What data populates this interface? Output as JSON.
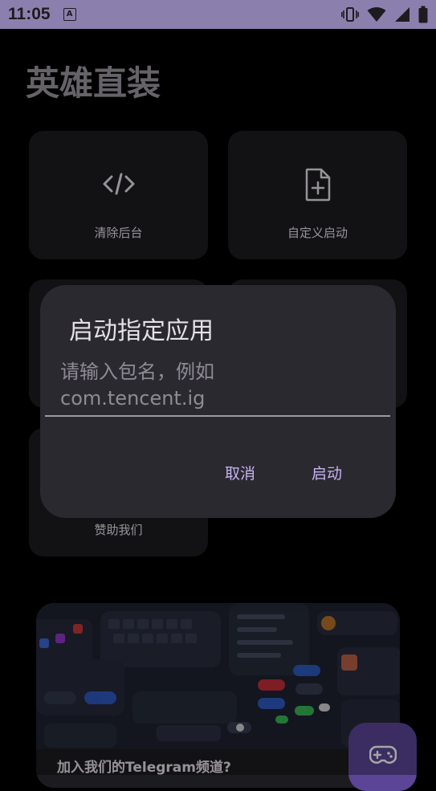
{
  "status_bar": {
    "time": "11:05",
    "notification_icon": "A",
    "icons": [
      "vibrate-icon",
      "wifi-icon",
      "cell-signal-icon",
      "battery-icon"
    ]
  },
  "app_title": "英雄直装",
  "cards": {
    "clear_background": {
      "label": "清除后台",
      "icon": "code-icon"
    },
    "custom_launch": {
      "label": "自定义启动",
      "icon": "file-add-icon"
    },
    "sponsor": {
      "label": "赞助我们"
    }
  },
  "banner": {
    "text": "加入我们的Telegram频道?",
    "image": "ui-kit-preview-image"
  },
  "fab": {
    "icon": "gamepad-icon"
  },
  "dialog": {
    "title": "启动指定应用",
    "input_value": "",
    "input_placeholder": "请输入包名，例如com.tencent.ig",
    "input_placeholder_lines": [
      "请输入包名，例如",
      "com.tencent.ig"
    ],
    "cancel_label": "取消",
    "confirm_label": "启动"
  },
  "colors": {
    "status_bar_bg": "#8b80ad",
    "card_bg": "#1c1b1f",
    "dialog_bg": "#2b2930",
    "accent": "#c5b3f0",
    "fab_bg": "#5b4596"
  }
}
